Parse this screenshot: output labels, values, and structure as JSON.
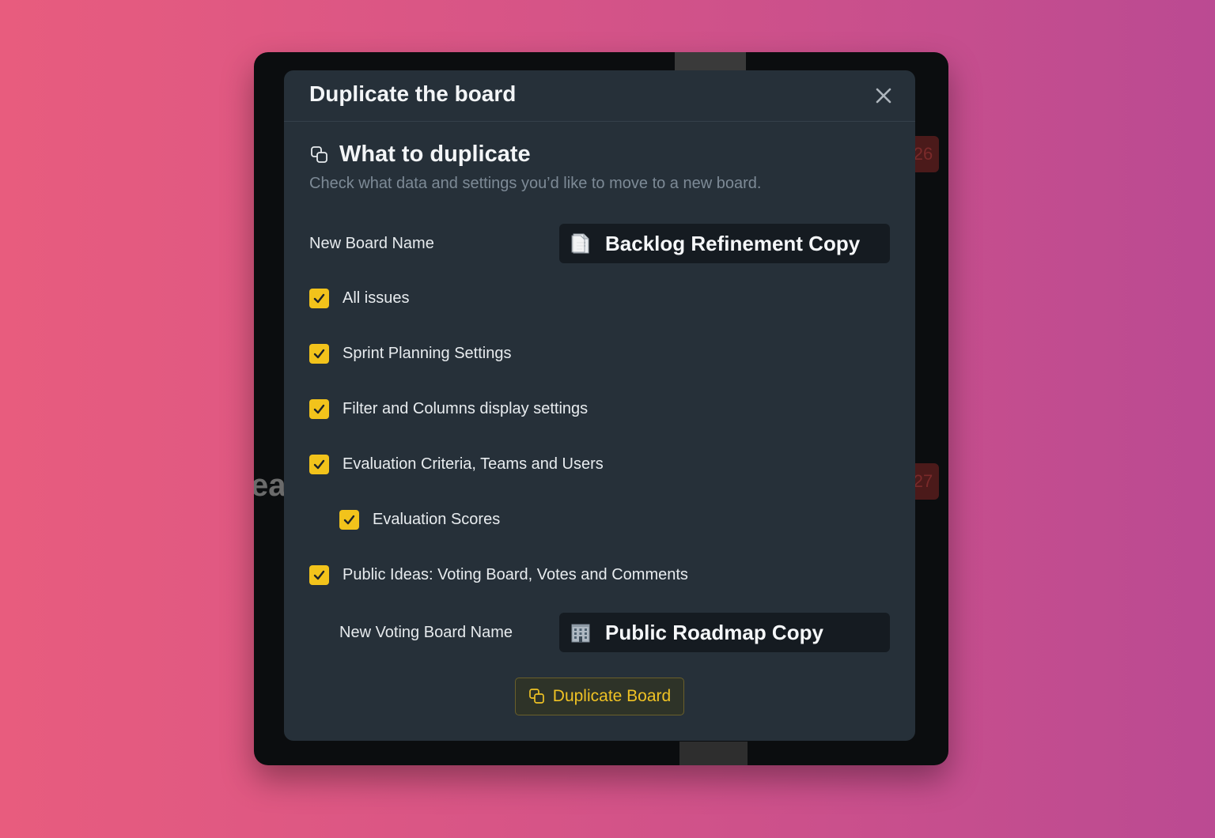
{
  "background_window": {
    "badge_top": "26",
    "badge_bottom": "27",
    "peek_text": "ea"
  },
  "modal": {
    "title": "Duplicate the board",
    "close_icon": "close-icon"
  },
  "section": {
    "icon": "duplicate-icon",
    "title": "What to duplicate",
    "description": "Check what data and settings you’d like to move to a new board."
  },
  "board_name": {
    "label": "New Board Name",
    "icon": "page-emoji-icon",
    "value": "Backlog Refinement Copy"
  },
  "options": [
    {
      "label": "All issues",
      "checked": true
    },
    {
      "label": "Sprint Planning Settings",
      "checked": true
    },
    {
      "label": "Filter and Columns display settings",
      "checked": true
    },
    {
      "label": "Evaluation Criteria, Teams and Users",
      "checked": true
    },
    {
      "label": "Evaluation Scores",
      "checked": true
    },
    {
      "label": "Public Ideas: Voting Board, Votes and Comments",
      "checked": true
    }
  ],
  "voting_board_name": {
    "label": "New Voting Board Name",
    "icon": "office-building-emoji-icon",
    "value": "Public Roadmap Copy"
  },
  "submit": {
    "icon": "duplicate-icon",
    "label": "Duplicate Board"
  },
  "colors": {
    "accent": "#f2c31b",
    "modal_bg": "#263039",
    "input_bg": "#151b21"
  }
}
